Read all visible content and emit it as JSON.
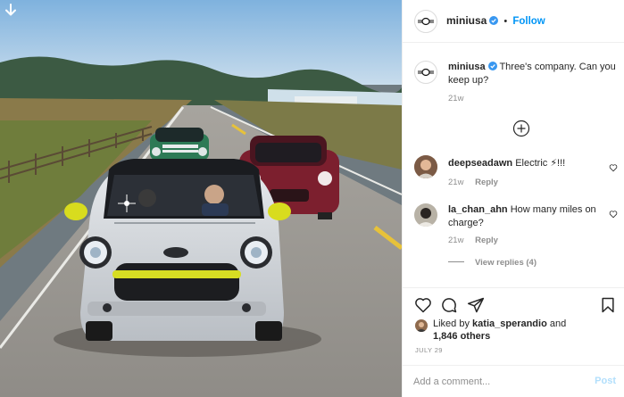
{
  "post": {
    "username": "miniusa",
    "follow_label": "Follow",
    "separator": "•"
  },
  "caption": {
    "username": "miniusa",
    "text": "Three's company. Can you keep up?",
    "time": "21w"
  },
  "comments": [
    {
      "username": "deepseadawn",
      "text": "Electric ⚡!!!",
      "time": "21w",
      "reply_label": "Reply"
    },
    {
      "username": "la_chan_ahn",
      "text": "How many miles on charge?",
      "time": "21w",
      "reply_label": "Reply",
      "view_replies": "View replies (4)"
    }
  ],
  "likes": {
    "prefix": "Liked by",
    "user": "katia_sperandio",
    "middle": "and",
    "count": "1,846 others"
  },
  "date": "JULY 29",
  "comment_box": {
    "placeholder": "Add a comment...",
    "post_label": "Post"
  },
  "colors": {
    "accent": "#0095f6",
    "post_disabled": "#b2dffc",
    "secondary_text": "#8e8e8e",
    "verified": "#3897f0"
  },
  "icons": [
    "download-arrow-icon",
    "mini-logo-icon",
    "verified-badge-icon",
    "add-circle-icon",
    "heart-icon",
    "comment-icon",
    "share-icon",
    "bookmark-icon"
  ]
}
